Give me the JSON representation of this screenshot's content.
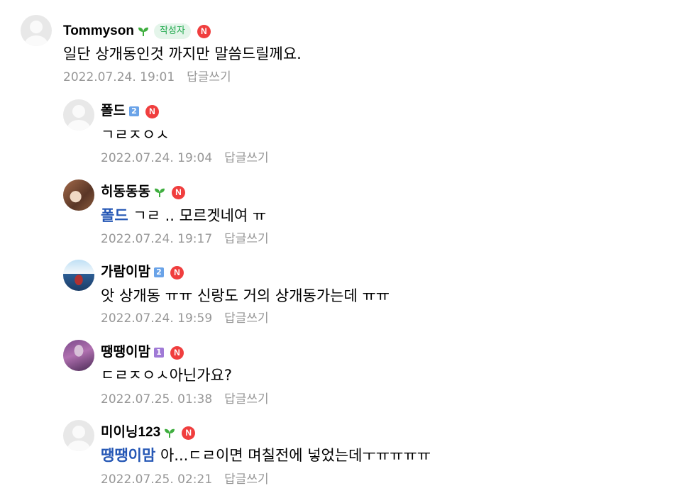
{
  "comments": [
    {
      "nickname": "Tommyson",
      "grade": "sprout",
      "author_badge": "작성자",
      "new_icon": "N",
      "text": "일단 상개동인것 까지만 말씀드릴께요.",
      "date": "2022.07.24. 19:01",
      "reply_label": "답글쓰기"
    },
    {
      "nickname": "폴드",
      "grade": "2",
      "new_icon": "N",
      "text": "ㄱㄹㅈㅇㅅ",
      "date": "2022.07.24. 19:04",
      "reply_label": "답글쓰기"
    },
    {
      "nickname": "히동동동",
      "grade": "sprout",
      "new_icon": "N",
      "mention": "폴드",
      "text": " ㄱㄹ .. 모르겟네여 ㅠ",
      "date": "2022.07.24. 19:17",
      "reply_label": "답글쓰기"
    },
    {
      "nickname": "가람이맘",
      "grade": "2",
      "new_icon": "N",
      "text": "앗 상개동 ㅠㅠ 신랑도 거의 상개동가는데 ㅠㅠ",
      "date": "2022.07.24. 19:59",
      "reply_label": "답글쓰기"
    },
    {
      "nickname": "땡땡이맘",
      "grade": "1",
      "new_icon": "N",
      "text": "ㄷㄹㅈㅇㅅ아닌가요?",
      "date": "2022.07.25. 01:38",
      "reply_label": "답글쓰기"
    },
    {
      "nickname": "미이닝123",
      "grade": "sprout",
      "new_icon": "N",
      "mention": "땡땡이맘",
      "text": " 아...ㄷㄹ이면 며칠전에 넣었는데ㅜㅠㅠㅠㅠ",
      "date": "2022.07.25. 02:21",
      "reply_label": "답글쓰기"
    }
  ],
  "icons": {
    "sprout_color": "#3fae3f",
    "new_color": "#f03e3e",
    "level2_color": "#6aa3e8",
    "level1_color": "#a07ad6",
    "mention_color": "#2557b5"
  }
}
